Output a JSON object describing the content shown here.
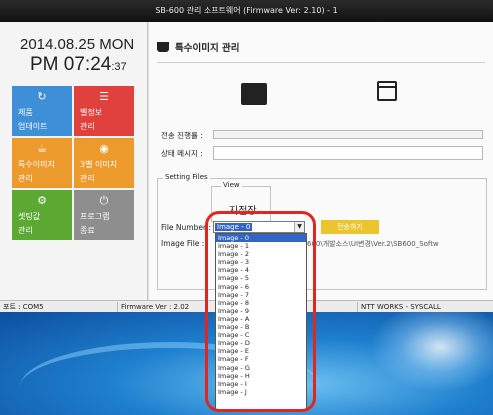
{
  "window": {
    "title": "SB-600 관리 소프트웨어 (Firmware Ver: 2.10) - 1"
  },
  "clock": {
    "date": "2014.08.25 MON",
    "time_main": "PM 07:24",
    "time_seconds": ":37"
  },
  "tiles": [
    {
      "icon": "refresh-icon",
      "line1": "제품",
      "line2": "업데이트",
      "color": "#3e8ed8"
    },
    {
      "icon": "list-icon",
      "line1": "벨정보",
      "line2": "관리",
      "color": "#e0413c"
    },
    {
      "icon": "cup-icon",
      "line1": "특수이미지",
      "line2": "관리",
      "color": "#ec9a2c"
    },
    {
      "icon": "clock-icon",
      "line1": "3벨 이미지",
      "line2": "관리",
      "color": "#ec9a2c"
    },
    {
      "icon": "gear-icon",
      "line1": "셋팅값",
      "line2": "관리",
      "color": "#5ba832"
    },
    {
      "icon": "power-icon",
      "line1": "프로그램",
      "line2": "종료",
      "color": "#8e8e8e"
    }
  ],
  "main": {
    "title": "특수이미지 관리",
    "progress_label": "전송 진행률 :",
    "status_label": "상태 메시지 :",
    "settings_group": "Setting Files",
    "view_group": "View",
    "view_value": "지점장",
    "file_number_label": "File Number :",
    "selected_image": "Image - 0",
    "send_button": "전송하기",
    "image_file_label": "Image File :",
    "image_file_path": "600\\개발소스\\UI변경\\Ver.2\\SB600_Softw"
  },
  "dropdown_options": [
    "Image - 0",
    "Image - 1",
    "Image - 2",
    "Image - 3",
    "Image - 4",
    "Image - 5",
    "Image - 6",
    "Image - 7",
    "Image - 8",
    "Image - 9",
    "Image - A",
    "Image - B",
    "Image - C",
    "Image - D",
    "Image - E",
    "Image - F",
    "Image - G",
    "Image - H",
    "Image - I",
    "Image - J"
  ],
  "statusbar": {
    "port": "포트 : COM5",
    "firmware": "Firmware Ver : 2.02",
    "company": "NTT WORKS - SYSCALL"
  },
  "colors": {
    "highlight": "#e0261f",
    "selection": "#3166c4",
    "send_button": "#ecc52e"
  }
}
